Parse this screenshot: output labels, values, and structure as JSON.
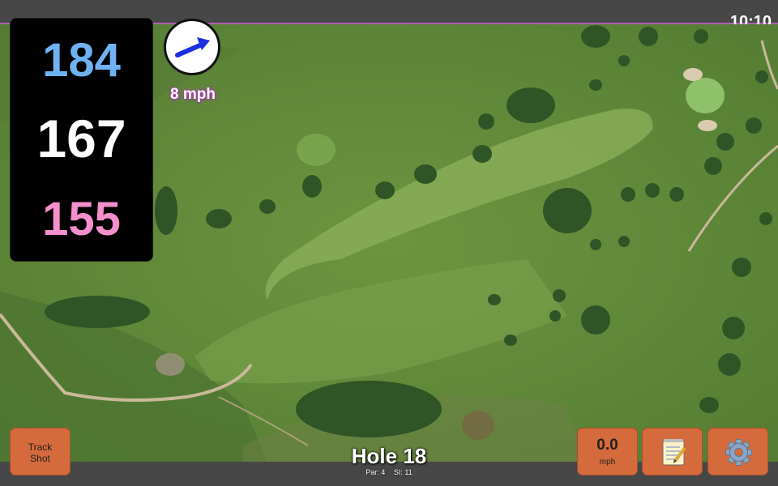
{
  "status": {
    "time": "10:10"
  },
  "yardages": {
    "back": "184",
    "middle": "167",
    "front": "155"
  },
  "wind": {
    "speed_label": "8 mph",
    "icon": "arrow-icon",
    "color": "#1a2fe0"
  },
  "hole": {
    "title": "Hole 18",
    "par_label": "Par: 4",
    "si_label": "SI: 11"
  },
  "buttons": {
    "track_line1": "Track",
    "track_line2": "Shot",
    "speed_value": "0.0",
    "speed_unit": "mph",
    "notes_icon": "notepad-icon",
    "settings_icon": "gear-icon"
  },
  "colors": {
    "button": "#d56a3c",
    "back_yardage": "#6fb2f2",
    "front_yardage": "#f58fcd",
    "accent": "#b05fb5"
  }
}
